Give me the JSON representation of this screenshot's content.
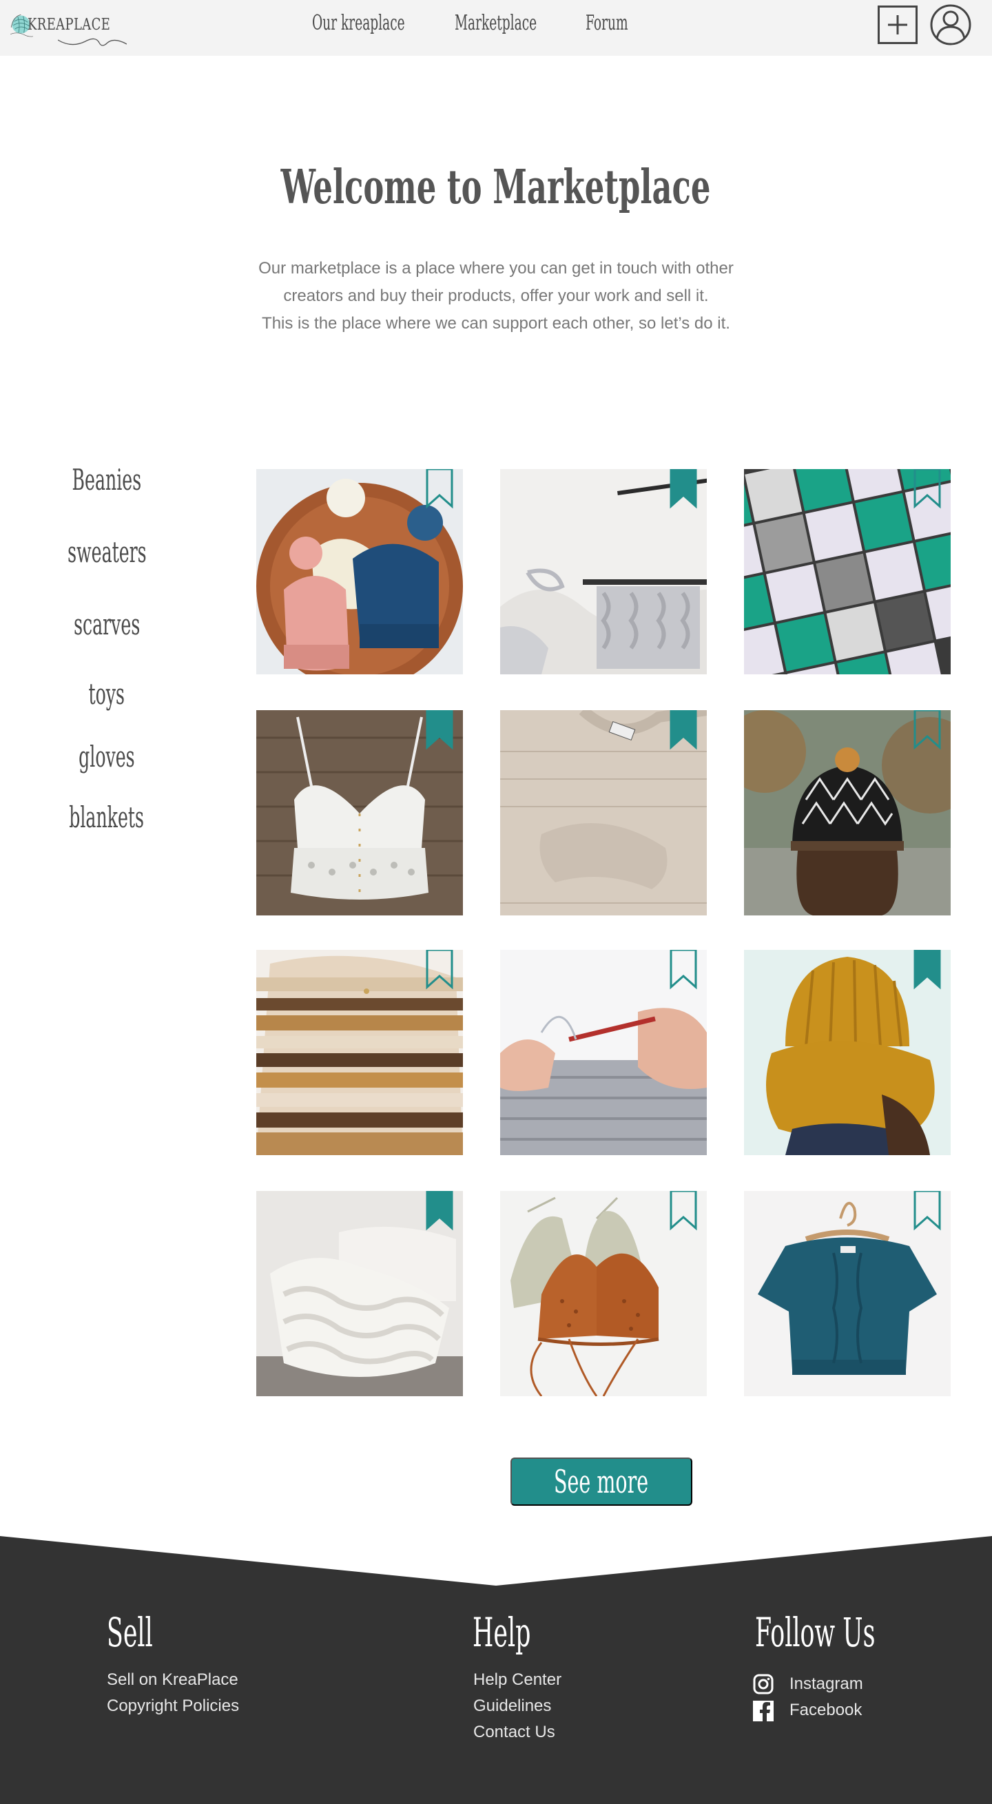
{
  "header": {
    "logo_text": "KREAPLACE",
    "nav": [
      "Our kreaplace",
      "Marketplace",
      "Forum"
    ]
  },
  "hero": {
    "title": "Welcome to Marketplace",
    "lines": [
      "Our marketplace is a place where you can get in touch with other",
      "creators and buy their products, offer your work and sell it.",
      "This is the place where we can support each other, so let’s do it."
    ]
  },
  "categories": [
    "Beanies",
    "sweaters",
    "scarves",
    "toys",
    "gloves",
    "blankets"
  ],
  "products": [
    {
      "name": "three pom-pom beanies",
      "bookmark": "outline"
    },
    {
      "name": "chunky cable knit swatch",
      "bookmark": "filled"
    },
    {
      "name": "granny square blanket",
      "bookmark": "outline"
    },
    {
      "name": "crochet bralette top",
      "bookmark": "filled"
    },
    {
      "name": "beige knit sweater",
      "bookmark": "filled"
    },
    {
      "name": "fair isle beanie",
      "bookmark": "outline"
    },
    {
      "name": "striped chunky sweater",
      "bookmark": "outline"
    },
    {
      "name": "crochet hook in progress",
      "bookmark": "outline"
    },
    {
      "name": "mustard hat and cowl",
      "bookmark": "filled"
    },
    {
      "name": "chunky knit throw",
      "bookmark": "filled"
    },
    {
      "name": "crochet bikini tops",
      "bookmark": "outline"
    },
    {
      "name": "teal knit top",
      "bookmark": "outline"
    }
  ],
  "see_more_label": "See more",
  "footer": {
    "sell": {
      "heading": "Sell",
      "links": [
        "Sell on KreaPlace",
        "Copyright Policies"
      ]
    },
    "help": {
      "heading": "Help",
      "links": [
        "Help Center",
        "Guidelines",
        "Contact Us"
      ]
    },
    "follow": {
      "heading": "Follow Us",
      "links": [
        "Instagram",
        "Facebook"
      ]
    }
  },
  "colors": {
    "accent": "#228e8b",
    "header_bg": "#f3f3f3",
    "footer_bg": "#333333",
    "text_dark": "#4a4a4a"
  },
  "icons": [
    "yarn-ball-logo-icon",
    "plus-icon",
    "user-icon",
    "bookmark-icon",
    "instagram-icon",
    "facebook-icon"
  ]
}
